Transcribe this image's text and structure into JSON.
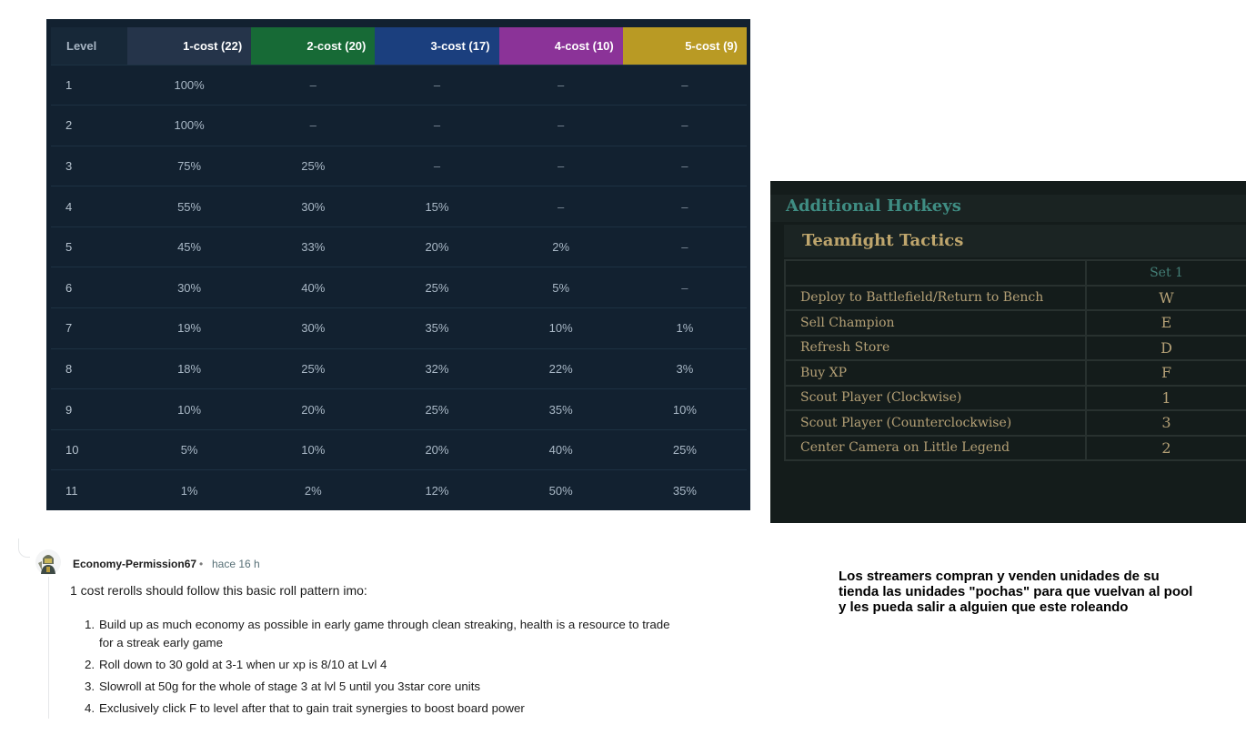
{
  "odds_table": {
    "columns": [
      {
        "label": "Level",
        "color": "#172838"
      },
      {
        "label": "1-cost (22)",
        "color": "#25344a"
      },
      {
        "label": "2-cost (20)",
        "color": "#176a36"
      },
      {
        "label": "3-cost (17)",
        "color": "#1b3f7e"
      },
      {
        "label": "4-cost (10)",
        "color": "#8b3398"
      },
      {
        "label": "5-cost (9)",
        "color": "#b99a24"
      }
    ],
    "rows": [
      [
        "1",
        "100%",
        "–",
        "–",
        "–",
        "–"
      ],
      [
        "2",
        "100%",
        "–",
        "–",
        "–",
        "–"
      ],
      [
        "3",
        "75%",
        "25%",
        "–",
        "–",
        "–"
      ],
      [
        "4",
        "55%",
        "30%",
        "15%",
        "–",
        "–"
      ],
      [
        "5",
        "45%",
        "33%",
        "20%",
        "2%",
        "–"
      ],
      [
        "6",
        "30%",
        "40%",
        "25%",
        "5%",
        "–"
      ],
      [
        "7",
        "19%",
        "30%",
        "35%",
        "10%",
        "1%"
      ],
      [
        "8",
        "18%",
        "25%",
        "32%",
        "22%",
        "3%"
      ],
      [
        "9",
        "10%",
        "20%",
        "25%",
        "35%",
        "10%"
      ],
      [
        "10",
        "5%",
        "10%",
        "20%",
        "40%",
        "25%"
      ],
      [
        "11",
        "1%",
        "2%",
        "12%",
        "50%",
        "35%"
      ]
    ]
  },
  "hotkeys": {
    "title": "Additional Hotkeys",
    "subtitle": "Teamfight Tactics",
    "column_header": "Set 1",
    "rows": [
      {
        "action": "Deploy to Battlefield/Return to Bench",
        "key": "W"
      },
      {
        "action": "Sell Champion",
        "key": "E"
      },
      {
        "action": "Refresh Store",
        "key": "D"
      },
      {
        "action": "Buy XP",
        "key": "F"
      },
      {
        "action": "Scout Player (Clockwise)",
        "key": "1"
      },
      {
        "action": "Scout Player (Counterclockwise)",
        "key": "3"
      },
      {
        "action": "Center Camera on Little Legend",
        "key": "2"
      }
    ]
  },
  "comment": {
    "author": "Economy-Permission67",
    "separator": "•",
    "time": "hace 16 h",
    "intro": "1 cost rerolls should follow this basic roll pattern imo:",
    "items": [
      {
        "num": "1.",
        "text": "Build up as much economy as possible in early game through clean streaking, health is a resource to trade for a streak early game"
      },
      {
        "num": "2.",
        "text": "Roll down to 30 gold at 3-1 when ur xp is 8/10 at Lvl 4"
      },
      {
        "num": "3.",
        "text": "Slowroll at 50g for the whole of stage 3 at lvl 5 until you 3star core units"
      },
      {
        "num": "4.",
        "text": "Exclusively click F to level after that to gain trait synergies to boost board power"
      }
    ]
  },
  "note": {
    "text": "Los streamers compran y venden unidades de su tienda las unidades \"pochas\" para que vuelvan al pool y les pueda salir a alguien que este roleando"
  }
}
